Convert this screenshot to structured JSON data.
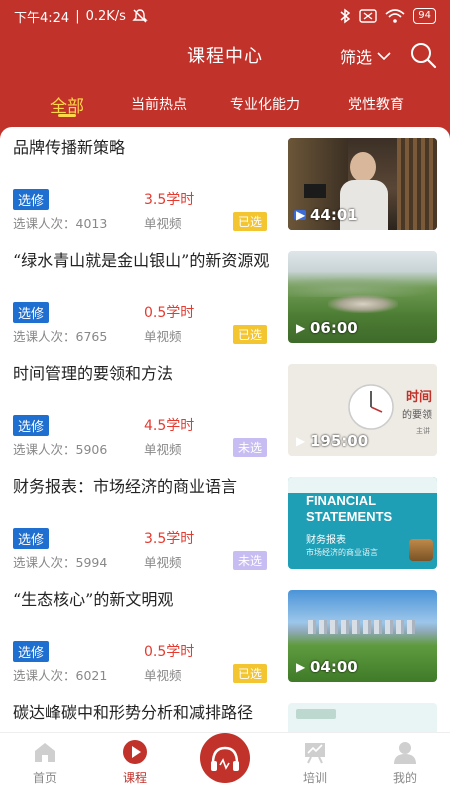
{
  "status": {
    "time": "下午4:24",
    "speed": "0.2K/s",
    "battery": "94"
  },
  "header": {
    "title": "课程中心",
    "filter_label": "筛选"
  },
  "tabs": [
    {
      "label": "全部"
    },
    {
      "label": "当前热点"
    },
    {
      "label": "专业化能力"
    },
    {
      "label": "党性教育"
    }
  ],
  "courses": [
    {
      "title": "品牌传播新策略",
      "badge": "选修",
      "hours": "3.5学时",
      "count": "选课人次：4013",
      "type": "单视频",
      "selected": "已选",
      "duration": "44:01"
    },
    {
      "title": "“绿水青山就是金山银山”的新资源观",
      "badge": "选修",
      "hours": "0.5学时",
      "count": "选课人次：6765",
      "type": "单视频",
      "selected": "已选",
      "duration": "06:00"
    },
    {
      "title": "时间管理的要领和方法",
      "badge": "选修",
      "hours": "4.5学时",
      "count": "选课人次：5906",
      "type": "单视频",
      "selected": "未选",
      "duration": "195:00",
      "thumb_text": "时间",
      "thumb_sub": "的要领",
      "thumb_small": "主讲"
    },
    {
      "title": "财务报表：市场经济的商业语言",
      "badge": "选修",
      "hours": "3.5学时",
      "count": "选课人次：5994",
      "type": "单视频",
      "selected": "未选",
      "thumb_text": "FINANCIAL",
      "thumb_text2": "STATEMENTS",
      "thumb_sub": "财务报表",
      "thumb_small": "市场经济的商业语言"
    },
    {
      "title": "“生态核心”的新文明观",
      "badge": "选修",
      "hours": "0.5学时",
      "count": "选课人次：6021",
      "type": "单视频",
      "selected": "已选",
      "duration": "04:00"
    },
    {
      "title": "碳达峰碳中和形势分析和减排路径",
      "badge": "",
      "hours": "",
      "count": "",
      "type": "",
      "selected": ""
    }
  ],
  "tabbar": [
    {
      "label": "首页",
      "icon": "home-icon"
    },
    {
      "label": "课程",
      "icon": "play-icon"
    },
    {
      "label": "",
      "icon": "headphones-icon"
    },
    {
      "label": "培训",
      "icon": "training-icon"
    },
    {
      "label": "我的",
      "icon": "user-icon"
    }
  ],
  "colors": {
    "primary": "#c0322a",
    "accent": "#ffd84a",
    "badge": "#1f6fd1",
    "hours": "#e43a2f",
    "selected": "#f3c531",
    "unselected": "#c8bdf2"
  }
}
